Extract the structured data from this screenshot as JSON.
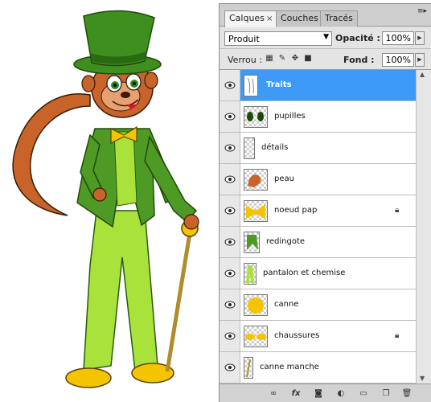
{
  "panel": {
    "tabs": [
      {
        "label": "Calques",
        "close": "×",
        "active": true
      },
      {
        "label": "Couches",
        "active": false
      },
      {
        "label": "Tracés",
        "active": false
      }
    ],
    "menu_icon": "panel-menu-icon",
    "blend_mode": "Produit",
    "opacity_label": "Opacité :",
    "opacity_value": "100%",
    "lock_label": "Verrou :",
    "fill_label": "Fond :",
    "fill_value": "100%"
  },
  "layers": [
    {
      "name": "Traits",
      "visible": true,
      "selected": true,
      "locked": false
    },
    {
      "name": "pupilles",
      "visible": true,
      "selected": false,
      "locked": false
    },
    {
      "name": "détails",
      "visible": true,
      "selected": false,
      "locked": false
    },
    {
      "name": "peau",
      "visible": true,
      "selected": false,
      "locked": false
    },
    {
      "name": "noeud pap",
      "visible": true,
      "selected": false,
      "locked": true
    },
    {
      "name": "redingote",
      "visible": true,
      "selected": false,
      "locked": false
    },
    {
      "name": "pantalon et chemise",
      "visible": true,
      "selected": false,
      "locked": false
    },
    {
      "name": "canne",
      "visible": true,
      "selected": false,
      "locked": false
    },
    {
      "name": "chaussures",
      "visible": true,
      "selected": false,
      "locked": true
    },
    {
      "name": "canne manche",
      "visible": true,
      "selected": false,
      "locked": false
    }
  ],
  "colors": {
    "selection": "#3d9af6",
    "hat_green": "#3f8f1e",
    "coat_green": "#4e9a24",
    "pants_green": "#a8e23a",
    "skin": "#c8642a",
    "yellow": "#f5c400"
  },
  "bottom_icons": [
    "link-icon",
    "fx-icon",
    "mask-icon",
    "adjustment-icon",
    "folder-icon",
    "new-layer-icon",
    "trash-icon"
  ]
}
